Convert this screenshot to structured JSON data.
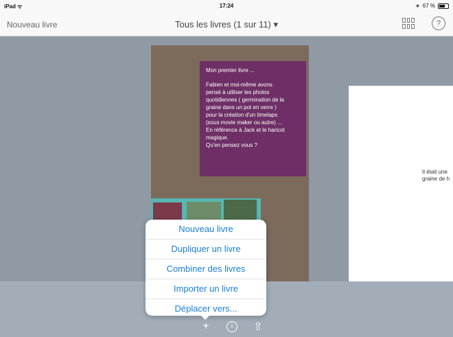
{
  "status": {
    "device": "iPad",
    "time": "17:24",
    "battery": "67 %"
  },
  "navbar": {
    "left_label": "Nouveau livre",
    "title": "Tous les livres (1 sur 11) ▾",
    "grid_icon": "grid-view-icon",
    "help_label": "?"
  },
  "book_left": {
    "heading": "Mon premier livre ...",
    "body": "Fabien et moi-même avons\npensé à utiliser les photos\nquotidiennes ( germination de la\ngraine dans un pot en verre )\npour la création d'un timelaps\n(sous movie maker ou autre) ...\nEn référence à Jack et le haricot\nmagique.\nQu'en pensez vous ?"
  },
  "book_right": {
    "text": "Il était une\ngraine de h"
  },
  "menu": {
    "items": [
      {
        "label": "Nouveau livre"
      },
      {
        "label": "Dupliquer un livre"
      },
      {
        "label": "Combiner des livres"
      },
      {
        "label": "Importer un livre"
      },
      {
        "label": "Déplacer vers..."
      }
    ]
  },
  "toolbar": {
    "add_symbol": "+",
    "info_symbol": "i",
    "share_symbol": "⇧"
  },
  "colors": {
    "accent": "#1a7fd4",
    "purple_card": "#6e2f66",
    "book_bg": "#7c6a5b"
  }
}
